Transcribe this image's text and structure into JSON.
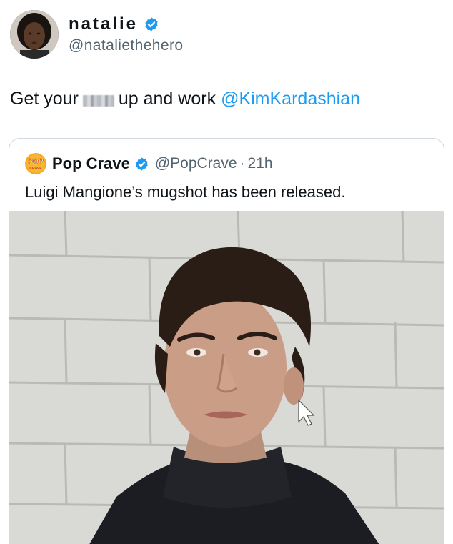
{
  "tweet": {
    "author": {
      "display_name": "natalie",
      "handle": "@nataliethehero",
      "verified": true,
      "avatar_icon": "profile-avatar"
    },
    "text": {
      "before": "Get your",
      "redacted": true,
      "after": "up and work",
      "mention": "@KimKardashian"
    }
  },
  "quote": {
    "author": {
      "display_name": "Pop Crave",
      "handle": "@PopCrave",
      "separator": "·",
      "time": "21h",
      "verified": true,
      "logo_text_top": "POP",
      "logo_text_bottom": "CRAVE"
    },
    "text": "Luigi Mangione’s mugshot has been released.",
    "media": {
      "type": "photo",
      "subject_icon": "mugshot-photo"
    }
  },
  "colors": {
    "verified": "#1d9bf0",
    "mention": "#1d9bf0",
    "secondary_text": "#536471",
    "border": "#cfd9de"
  }
}
